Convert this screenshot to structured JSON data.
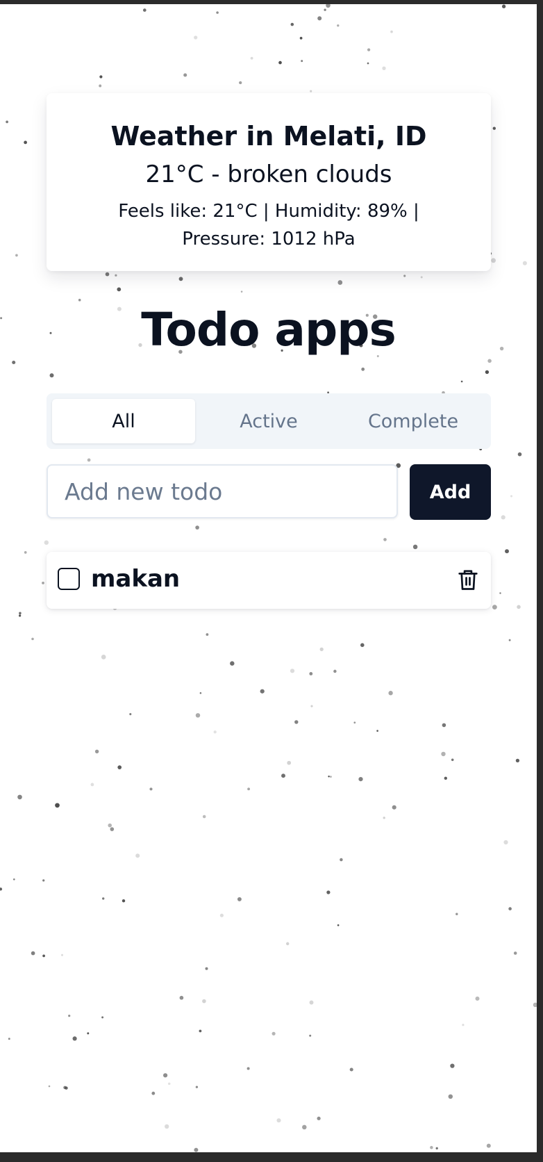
{
  "weather": {
    "title": "Weather in Melati, ID",
    "summary": "21°C - broken clouds",
    "details": "Feels like: 21°C | Humidity: 89% | Pressure: 1012 hPa"
  },
  "app": {
    "title": "Todo apps"
  },
  "filters": {
    "tabs": [
      {
        "label": "All",
        "selected": true
      },
      {
        "label": "Active",
        "selected": false
      },
      {
        "label": "Complete",
        "selected": false
      }
    ]
  },
  "new_todo": {
    "placeholder": "Add new todo",
    "value": "",
    "button_label": "Add"
  },
  "todos": [
    {
      "text": "makan",
      "completed": false
    }
  ],
  "icons": {
    "delete": "trash-icon",
    "checkbox": "checkbox-icon"
  },
  "colors": {
    "primary": "#0f172a",
    "text": "#0b1220",
    "muted": "#64748b",
    "tabs_bg": "#f1f5f9"
  }
}
